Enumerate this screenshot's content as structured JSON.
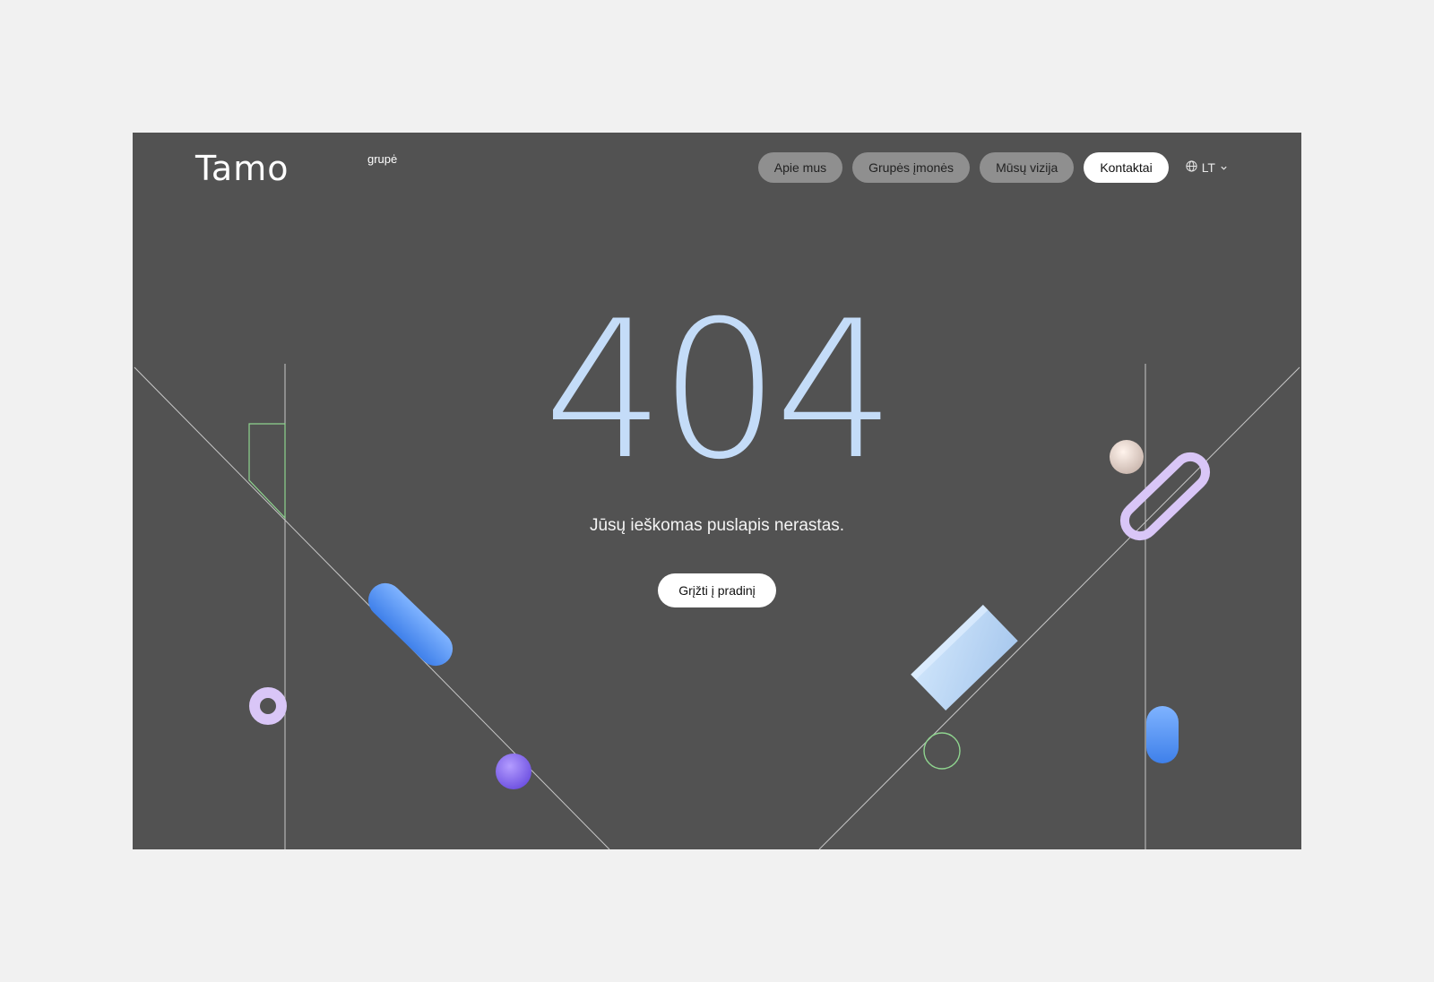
{
  "logo": {
    "word": "Tamo",
    "sup": "grupė"
  },
  "nav": {
    "items": [
      "Apie mus",
      "Grupės įmonės",
      "Mūsų vizija"
    ],
    "contact": "Kontaktai",
    "lang": "LT"
  },
  "main": {
    "code": "404",
    "message": "Jūsų ieškomas puslapis nerastas.",
    "cta": "Grįžti į pradinį"
  },
  "colors": {
    "page_bg": "#f1f1f1",
    "frame_bg": "#525252",
    "code": "#c4dcf8",
    "accent_blue": "#4b8ff0",
    "lavender": "#d9c6f7",
    "purple": "#8a6cf0"
  }
}
